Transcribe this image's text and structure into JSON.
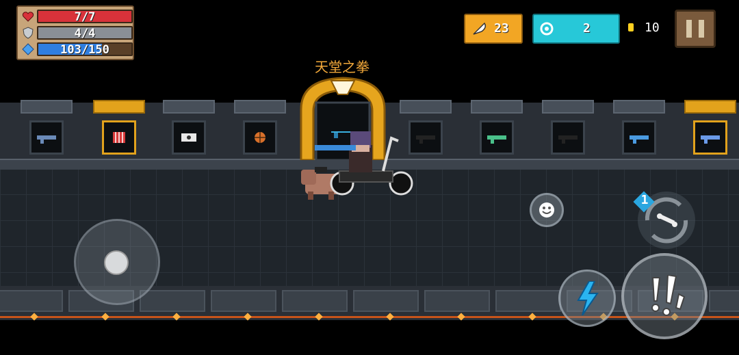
{
  "hud": {
    "health": {
      "text": "7/7",
      "fraction": 1.0,
      "color": "#d8323a"
    },
    "armor": {
      "text": "4/4",
      "fraction": 1.0,
      "color": "#8a8f96"
    },
    "energy": {
      "text": "103/150",
      "fraction": 0.687,
      "color": "#2f7ee0"
    }
  },
  "currency": {
    "gems": "23",
    "energy_crystals": "2",
    "coins": "10"
  },
  "weapon_display": {
    "featured_name": "天堂之拳",
    "slots": [
      {
        "icon": "staff-weapon-icon",
        "gold": false
      },
      {
        "icon": "dynamite-weapon-icon",
        "gold": true
      },
      {
        "icon": "dice-weapon-icon",
        "gold": false
      },
      {
        "icon": "basketball-weapon-icon",
        "gold": false
      },
      {
        "icon": "blaster-weapon-icon",
        "gold": false,
        "featured": true
      },
      {
        "icon": "silhouette-gun-icon",
        "gold": false
      },
      {
        "icon": "green-rifle-icon",
        "gold": false
      },
      {
        "icon": "silhouette-cannon-icon",
        "gold": false
      },
      {
        "icon": "laser-pistol-icon",
        "gold": false
      },
      {
        "icon": "crossbow-weapon-icon",
        "gold": true
      }
    ]
  },
  "controls": {
    "swap_count": "1",
    "secondary_weapon_icon": "bone-icon"
  }
}
